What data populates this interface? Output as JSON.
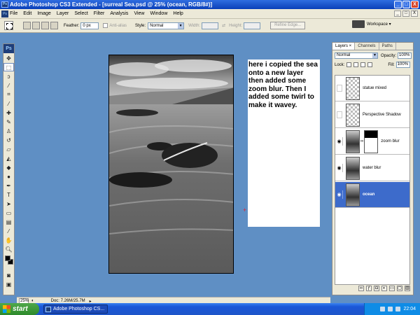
{
  "window": {
    "title": "Adobe Photoshop CS3 Extended - [surreal Sea.psd @ 25% (ocean, RGB/8#)]",
    "app_icon": "Ps",
    "min": "_",
    "max": "□",
    "close": "X"
  },
  "menu": [
    "File",
    "Edit",
    "Image",
    "Layer",
    "Select",
    "Filter",
    "Analysis",
    "View",
    "Window",
    "Help"
  ],
  "options": {
    "feather_label": "Feather:",
    "feather_value": "0 px",
    "antialias_label": "Anti-alias",
    "style_label": "Style:",
    "style_value": "Normal",
    "width_label": "Width:",
    "height_label": "Height:",
    "refine_edge": "Refine Edge...",
    "workspace": "Workspace ▾"
  },
  "toolbox": {
    "badge": "Ps"
  },
  "note": {
    "text": "here i copied the sea onto a new layer then added some zoom blur. Then I added some twirl to make it wavey."
  },
  "status": {
    "zoom": "25%",
    "doc": "Doc: 7.26M/25.7M"
  },
  "panel": {
    "tabs": [
      "Layers ×",
      "Channels",
      "Paths"
    ],
    "blend_mode": "Normal",
    "opacity_label": "Opacity:",
    "opacity_value": "100%",
    "lock_label": "Lock:",
    "fill_label": "Fill:",
    "fill_value": "100%",
    "layers": [
      {
        "name": "statue mixed",
        "visible": false
      },
      {
        "name": "Perspective Shadow",
        "visible": false
      },
      {
        "name": "zoom blur",
        "visible": true
      },
      {
        "name": "water blur",
        "visible": true
      },
      {
        "name": "ocean",
        "visible": true,
        "selected": true
      }
    ]
  },
  "taskbar": {
    "start": "start",
    "task": "Adobe Photoshop CS...",
    "lang": "EN",
    "clock": "22:04"
  },
  "colors": {
    "workspace_bg": "#5f8fc4",
    "selected_layer": "#3d6bcb",
    "title_bar": "#0a3fb8"
  }
}
